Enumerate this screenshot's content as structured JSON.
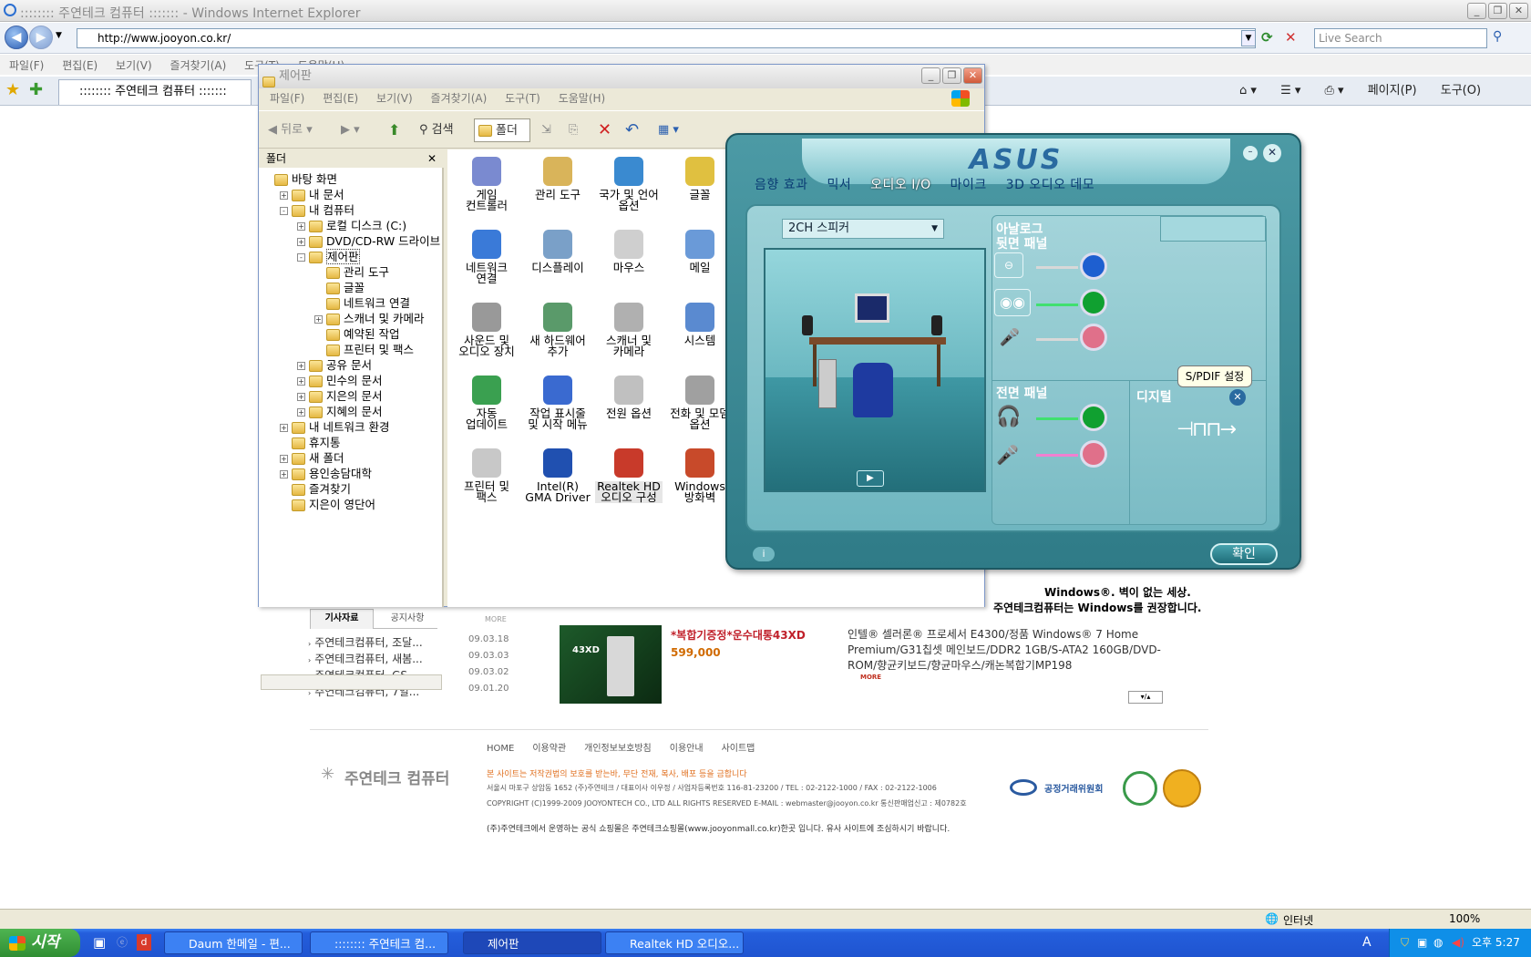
{
  "ie": {
    "title": ":::::::: 주연테크 컴퓨터 ::::::: - Windows Internet Explorer",
    "url": "http://www.jooyon.co.kr/",
    "search_placeholder": "Live Search",
    "menu": [
      "파일(F)",
      "편집(E)",
      "보기(V)",
      "즐겨찾기(A)",
      "도구(T)",
      "도움말(H)"
    ],
    "tab": ":::::::: 주연테크 컴퓨터 :::::::",
    "cmd": [
      "페이지(P)",
      "도구(O)"
    ],
    "status_zone": "인터넷",
    "zoom": "100%"
  },
  "web": {
    "tabs": [
      "기사자료",
      "공지사항"
    ],
    "more": "MORE",
    "news": [
      {
        "t": "주연테크컴퓨터, 조달...",
        "d": "09.03.18"
      },
      {
        "t": "주연테크컴퓨터, 새봄...",
        "d": "09.03.03"
      },
      {
        "t": "주연테크컴퓨터, GS...",
        "d": "09.03.02"
      },
      {
        "t": "주연테크컴퓨터, 7일...",
        "d": "09.01.20"
      }
    ],
    "product_badge": "43XD",
    "promo": "*복합기증정*운수대통43XD",
    "price": "599,000",
    "desc": "인텔® 셀러론® 프로세서 E4300/정품 Windows® 7 Home Premium/G31칩셋 메인보드/DDR2 1GB/S-ATA2 160GB/DVD-ROM/향균키보드/향균마우스/캐논복합기MP198",
    "desc_more": "MORE",
    "win_slogan1": "Windows®. 벽이 없는 세상.",
    "win_slogan2": "주연테크컴퓨터는 Windows를 권장합니다.",
    "footer_links": [
      "HOME",
      "이용약관",
      "개인정보보호방침",
      "이용안내",
      "사이트맵"
    ],
    "logo": "주연테크 컴퓨터",
    "copy_warn": "본 사이트는 저작권법의 보호를 받는바, 무단 전재, 복사, 배포 등을 금합니다",
    "address": "서울시 마포구 상암동 1652 (주)주연테크  /  대표이사 이우정  /  사업자등록번호 116-81-23200  /  TEL : 02-2122-1000  /  FAX : 02-2122-1006",
    "copyright": "COPYRIGHT (C)1999-2009 JOOYONTECH CO., LTD  ALL RIGHTS RESERVED   E-MAIL : webmaster@jooyon.co.kr    통신판매업신고 : 제0782호",
    "mall_note": "(주)주연테크에서 운영하는 공식 쇼핑몰은 주연테크쇼핑몰(www.jooyonmall.co.kr)한곳 입니다. 유사 사이트에 조심하시기 바랍니다.",
    "ftc": "공정거래위원회"
  },
  "explorer": {
    "title": "제어판",
    "menu": [
      "파일(F)",
      "편집(E)",
      "보기(V)",
      "즐겨찾기(A)",
      "도구(T)",
      "도움말(H)"
    ],
    "back": "뒤로",
    "search": "검색",
    "folders_btn": "폴더",
    "folders_label": "폴더",
    "tree": [
      {
        "l": "바탕 화면",
        "lvl": 0,
        "pm": ""
      },
      {
        "l": "내 문서",
        "lvl": 1,
        "pm": "+"
      },
      {
        "l": "내 컴퓨터",
        "lvl": 1,
        "pm": "-"
      },
      {
        "l": "로컬 디스크 (C:)",
        "lvl": 2,
        "pm": "+"
      },
      {
        "l": "DVD/CD-RW 드라이브 (D:)",
        "lvl": 2,
        "pm": "+"
      },
      {
        "l": "제어판",
        "lvl": 2,
        "pm": "-"
      },
      {
        "l": "관리 도구",
        "lvl": 3,
        "pm": ""
      },
      {
        "l": "글꼴",
        "lvl": 3,
        "pm": ""
      },
      {
        "l": "네트워크 연결",
        "lvl": 3,
        "pm": ""
      },
      {
        "l": "스캐너 및 카메라",
        "lvl": 3,
        "pm": "+"
      },
      {
        "l": "예약된 작업",
        "lvl": 3,
        "pm": ""
      },
      {
        "l": "프린터 및 팩스",
        "lvl": 3,
        "pm": ""
      },
      {
        "l": "공유 문서",
        "lvl": 2,
        "pm": "+"
      },
      {
        "l": "민수의 문서",
        "lvl": 2,
        "pm": "+"
      },
      {
        "l": "지은의 문서",
        "lvl": 2,
        "pm": "+"
      },
      {
        "l": "지혜의 문서",
        "lvl": 2,
        "pm": "+"
      },
      {
        "l": "내 네트워크 환경",
        "lvl": 1,
        "pm": "+"
      },
      {
        "l": "휴지통",
        "lvl": 1,
        "pm": ""
      },
      {
        "l": "새 폴더",
        "lvl": 1,
        "pm": "+"
      },
      {
        "l": "용인송담대학",
        "lvl": 1,
        "pm": "+"
      },
      {
        "l": "즐겨찾기",
        "lvl": 1,
        "pm": ""
      },
      {
        "l": "지은이 영단어",
        "lvl": 1,
        "pm": ""
      }
    ],
    "items": [
      {
        "l": "게임\n컨트롤러",
        "c": "#7a8ad0"
      },
      {
        "l": "관리 도구",
        "c": "#d9b45a"
      },
      {
        "l": "국가 및 언어\n옵션",
        "c": "#3a8ad0"
      },
      {
        "l": "글꼴",
        "c": "#e0c040"
      },
      {
        "l": "네트워크\n연결",
        "c": "#3a7ad8"
      },
      {
        "l": "디스플레이",
        "c": "#7aa0c8"
      },
      {
        "l": "마우스",
        "c": "#cfcfcf"
      },
      {
        "l": "메일",
        "c": "#6a9ad8"
      },
      {
        "l": "사운드 및\n오디오 장치",
        "c": "#999999"
      },
      {
        "l": "새 하드웨어\n추가",
        "c": "#5a9a6a"
      },
      {
        "l": "스캐너 및\n카메라",
        "c": "#b0b0b0"
      },
      {
        "l": "시스템",
        "c": "#5a8ad0"
      },
      {
        "l": "자동\n업데이트",
        "c": "#3aa050"
      },
      {
        "l": "작업 표시줄\n및 시작 메뉴",
        "c": "#3a6ad0"
      },
      {
        "l": "전원 옵션",
        "c": "#c0c0c0"
      },
      {
        "l": "전화 및 모뎀\n옵션",
        "c": "#a0a0a0"
      },
      {
        "l": "프린터 및\n팩스",
        "c": "#c8c8c8"
      },
      {
        "l": "Intel(R)\nGMA Driver",
        "c": "#2050b0"
      },
      {
        "l": "Realtek HD\n오디오 구성",
        "c": "#c83a2a"
      },
      {
        "l": "Windows\n방화벽",
        "c": "#c84a2a"
      }
    ]
  },
  "asus": {
    "logo": "ASUS",
    "tabs": [
      "음향 효과",
      "믹서",
      "오디오 I/O",
      "마이크",
      "3D 오디오 데모"
    ],
    "speaker_select": "2CH 스피커",
    "analog": "아날로그",
    "rear_panel": "뒷면 패널",
    "front_panel": "전면 패널",
    "digital": "디지털",
    "tooltip": "S/PDIF 설정",
    "ok": "확인",
    "colors": {
      "blue": "#1e5fd0",
      "green": "#10a030",
      "pink": "#e0708a"
    }
  },
  "taskbar": {
    "start": "시작",
    "tasks": [
      "Daum 한메일 - 편...",
      ":::::::: 주연테크 컴...",
      "제어판",
      "Realtek HD 오디오..."
    ],
    "active": 2,
    "time": "오후 5:27"
  }
}
